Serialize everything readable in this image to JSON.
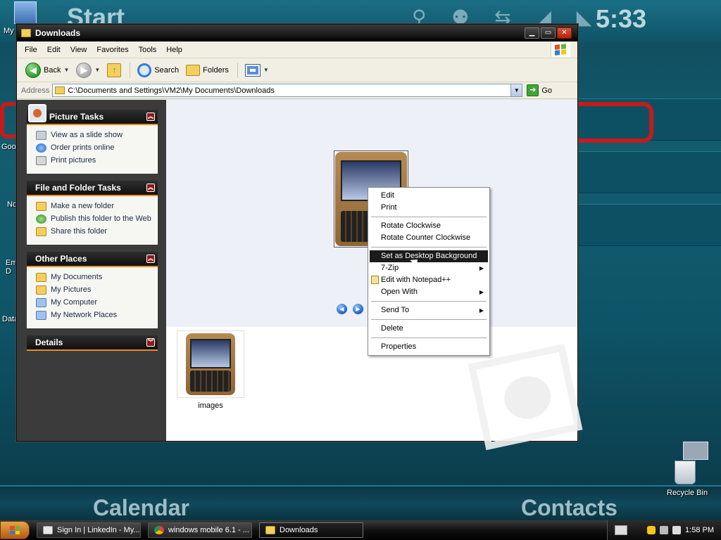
{
  "desktop": {
    "bg_start": "Start",
    "bg_clock": "5:33",
    "bg_calendar": "Calendar",
    "bg_contacts": "Contacts",
    "icons": [
      {
        "label": "My"
      },
      {
        "label": "Goo"
      },
      {
        "label": "No"
      },
      {
        "label": "Em\nD"
      },
      {
        "label": "Data"
      }
    ],
    "recycle_bin": "Recycle Bin"
  },
  "window": {
    "title": "Downloads",
    "menu": [
      "File",
      "Edit",
      "View",
      "Favorites",
      "Tools",
      "Help"
    ],
    "toolbar": {
      "back": "Back",
      "search": "Search",
      "folders": "Folders"
    },
    "address": {
      "label": "Address",
      "value": "C:\\Documents and Settings\\VM2\\My Documents\\Downloads",
      "go": "Go"
    },
    "tasks": {
      "picture_tasks": {
        "title": "Picture Tasks",
        "items": [
          "View as a slide show",
          "Order prints online",
          "Print pictures"
        ]
      },
      "file_folder_tasks": {
        "title": "File and Folder Tasks",
        "items": [
          "Make a new folder",
          "Publish this folder to the Web",
          "Share this folder"
        ]
      },
      "other_places": {
        "title": "Other Places",
        "items": [
          "My Documents",
          "My Pictures",
          "My Computer",
          "My Network Places"
        ]
      },
      "details": {
        "title": "Details"
      }
    },
    "files": [
      {
        "name": "images"
      }
    ]
  },
  "context_menu": {
    "items": [
      {
        "label": "Edit"
      },
      {
        "label": "Print"
      },
      {
        "sep": true
      },
      {
        "label": "Rotate Clockwise"
      },
      {
        "label": "Rotate Counter Clockwise"
      },
      {
        "sep": true
      },
      {
        "label": "Set as Desktop Background",
        "selected": true
      },
      {
        "label": "7-Zip",
        "submenu": true
      },
      {
        "label": "Edit with Notepad++",
        "icon": "notepadpp-icon"
      },
      {
        "label": "Open With",
        "submenu": true
      },
      {
        "sep": true
      },
      {
        "label": "Send To",
        "submenu": true
      },
      {
        "sep": true
      },
      {
        "label": "Delete"
      },
      {
        "sep": true
      },
      {
        "label": "Properties"
      }
    ]
  },
  "taskbar": {
    "tasks": [
      {
        "label": "Sign In | LinkedIn - My...",
        "icon": "document-icon"
      },
      {
        "label": "windows mobile 6.1 - ...",
        "icon": "chrome-icon"
      },
      {
        "label": "Downloads",
        "icon": "folder-icon",
        "active": true
      }
    ],
    "clock": "1:58 PM"
  },
  "colors": {
    "accent_orange": "#ea8d1b",
    "selection_black": "#1b1b1b",
    "desktop_teal": "#135d70"
  }
}
